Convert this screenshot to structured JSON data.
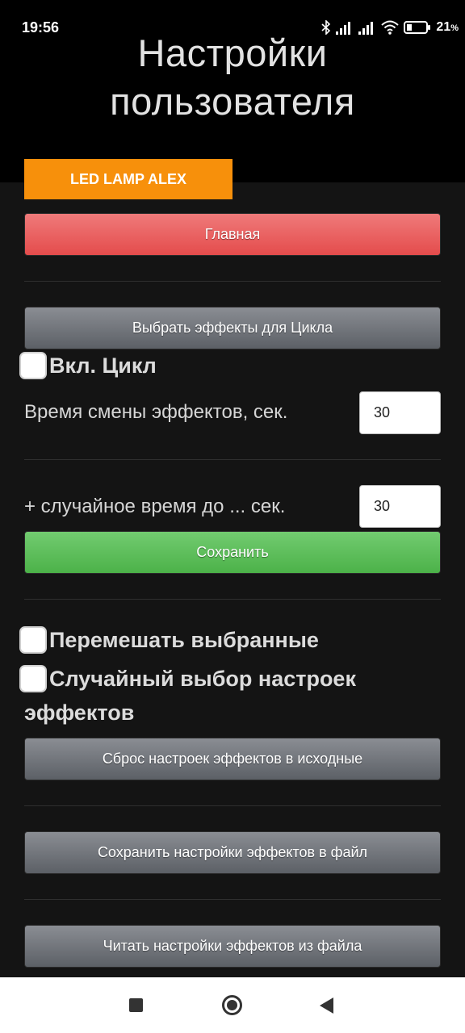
{
  "status_bar": {
    "time": "19:56",
    "battery_percent": "21",
    "battery_suffix": "%",
    "icons": [
      "bluetooth-icon",
      "signal-icon",
      "signal-icon",
      "wifi-icon",
      "battery-icon"
    ]
  },
  "header": {
    "title_line1": "Настройки",
    "title_line2": "пользователя"
  },
  "lamp_tab": "LED LAMP ALEX",
  "buttons": {
    "main": "Главная",
    "select_effects": "Выбрать эффекты для Цикла",
    "save": "Сохранить",
    "reset": "Сброс настроек эффектов в исходные",
    "save_to_file": "Сохранить настройки эффектов в файл",
    "read_from_file": "Читать настройки эффектов из файла"
  },
  "cycle": {
    "enable_label": "Вкл. Цикл",
    "enable_checked": false,
    "change_time_label": "Время смены эффектов, сек.",
    "change_time_value": "30",
    "random_time_label": "+ случайное время до ... сек.",
    "random_time_value": "30"
  },
  "options": {
    "shuffle_label": "Перемешать выбранные",
    "shuffle_checked": false,
    "random_settings_line1": "Случайный выбор настроек",
    "random_settings_line2": "эффектов",
    "random_settings_checked": false
  },
  "colors": {
    "accent_orange": "#f7900b",
    "main_red": "#e44c4c",
    "save_green": "#4cb249",
    "button_gray": "#6b6e73",
    "background": "#141414"
  }
}
